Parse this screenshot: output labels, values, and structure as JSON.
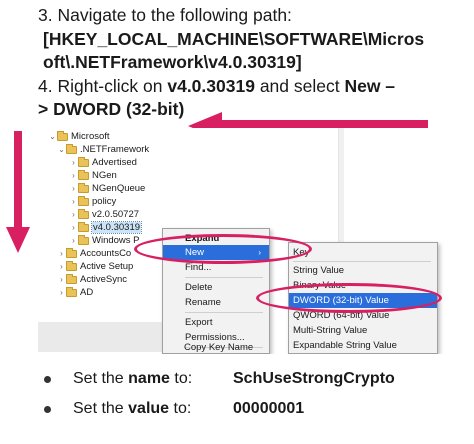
{
  "instructions": {
    "step3_prefix": "3. Navigate to the following path:",
    "path_line1": "[HKEY_LOCAL_MACHINE\\SOFTWARE\\Micros",
    "path_line2": "oft\\.NETFramework\\v4.0.30319]",
    "step4_prefix": "4. Right-click on ",
    "step4_key": "v4.0.30319",
    "step4_mid": " and select ",
    "step4_new": "New –",
    "step4_line2": "> DWORD (32-bit)"
  },
  "accent_color": "#d81f62",
  "tree": {
    "items": [
      {
        "label": "Microsoft",
        "level": 0,
        "expanded": true
      },
      {
        "label": ".NETFramework",
        "level": 1,
        "expanded": true
      },
      {
        "label": "Advertised",
        "level": 2
      },
      {
        "label": "NGen",
        "level": 2
      },
      {
        "label": "NGenQueue",
        "level": 2
      },
      {
        "label": "policy",
        "level": 2
      },
      {
        "label": "v2.0.50727",
        "level": 2
      },
      {
        "label": "v4.0.30319",
        "level": 2,
        "selected": true
      },
      {
        "label": "Windows P",
        "level": 2
      },
      {
        "label": "AccountsCo",
        "level": 1
      },
      {
        "label": "Active Setup",
        "level": 1
      },
      {
        "label": "ActiveSync",
        "level": 1
      },
      {
        "label": "AD",
        "level": 1
      }
    ]
  },
  "context_menu": {
    "items": [
      "Expand",
      "New",
      "Find...",
      "Delete",
      "Rename",
      "Export",
      "Permissions...",
      "Copy Key Name"
    ]
  },
  "submenu": {
    "items": [
      "Key",
      "String Value",
      "Binary Value",
      "DWORD (32-bit) Value",
      "QWORD (64-bit) Value",
      "Multi-String Value",
      "Expandable String Value"
    ]
  },
  "settings": [
    {
      "label_pre": "Set the ",
      "label_bold": "name",
      "label_post": " to:",
      "value": "SchUseStrongCrypto"
    },
    {
      "label_pre": "Set the ",
      "label_bold": "value",
      "label_post": " to:",
      "value": "00000001"
    }
  ]
}
